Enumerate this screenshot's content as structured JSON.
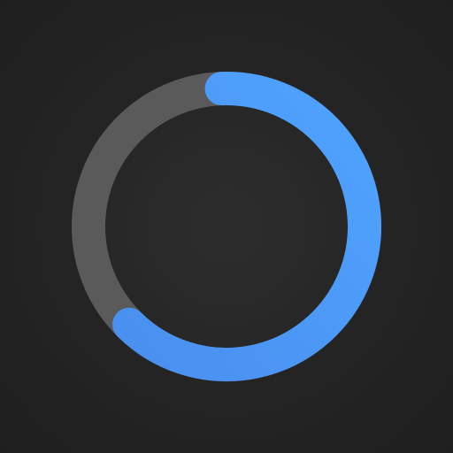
{
  "spinner": {
    "progress": 0.63,
    "colors": {
      "track": "#5a5a5a",
      "indicator": "#4fa3ff",
      "indicator_end": "#4a8fef"
    }
  }
}
